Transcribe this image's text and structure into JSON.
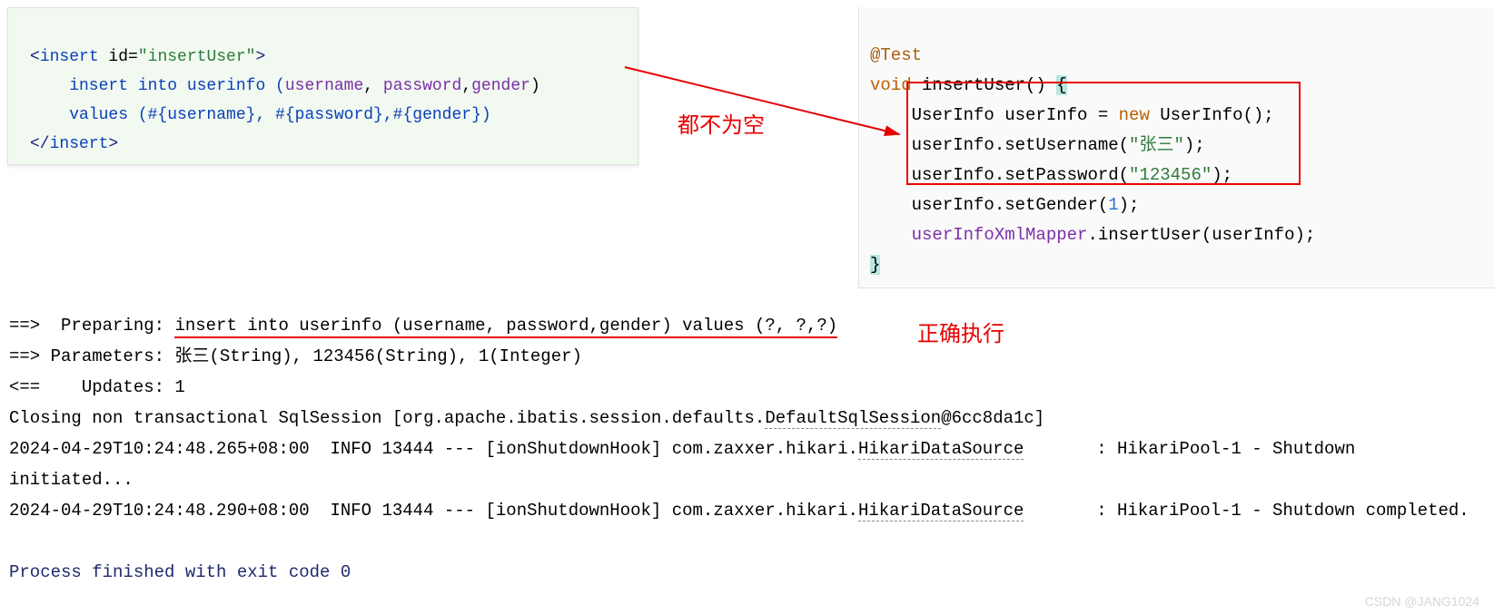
{
  "xml": {
    "open_tag_lt": "<",
    "open_tag_name": "insert",
    "attr_name": " id",
    "attr_eq": "=",
    "attr_val": "\"insertUser\"",
    "open_tag_gt": ">",
    "line2a": "    insert into userinfo (",
    "line2b": "username",
    "line2c": ", ",
    "line2d": "password",
    "line2e": ",",
    "line2f": "gender",
    "line2g": ")",
    "line3": "    values (#{username}, #{password},#{gender})",
    "close_lt": "</",
    "close_name": "insert",
    "close_gt": ">"
  },
  "java": {
    "ann": "@Test",
    "kw_void": "void",
    "method": " insertUser() ",
    "brace_open": "{",
    "line3a": "    UserInfo userInfo = ",
    "kw_new": "new",
    "line3b": " UserInfo();",
    "line4a": "    userInfo.setUsername(",
    "str1": "\"张三\"",
    "line4b": ");",
    "line5a": "    userInfo.setPassword(",
    "str2": "\"123456\"",
    "line5b": ");",
    "line6a": "    userInfo.setGender(",
    "num1": "1",
    "line6b": ");",
    "line7a": "    ",
    "mapper": "userInfoXmlMapper",
    "line7b": ".insertUser(userInfo);",
    "brace_close": "}"
  },
  "labels": {
    "not_empty": "都不为空",
    "correct_exec": "正确执行"
  },
  "console": {
    "l1a": "==>  Preparing: ",
    "l1b": "insert into userinfo (username, password,gender) values (?, ?,?)",
    "l2": "==> Parameters: 张三(String), 123456(String), 1(Integer)",
    "l3": "<==    Updates: 1",
    "l4a": "Closing non transactional SqlSession [org.apache.ibatis.session.defaults.",
    "l4b": "DefaultSqlSession",
    "l4c": "@6cc8da1c]",
    "l5a": "2024-04-29T10:24:48.265+08:00  INFO 13444 --- [ionShutdownHook] com.zaxxer.hikari.",
    "l5b": "HikariDataSource",
    "l5c": "       : HikariPool-1 - Shutdown initiated...",
    "l6a": "2024-04-29T10:24:48.290+08:00  INFO 13444 --- [ionShutdownHook] com.zaxxer.hikari.",
    "l6b": "HikariDataSource",
    "l6c": "       : HikariPool-1 - Shutdown completed.",
    "l7": "Process finished with exit code 0"
  },
  "watermark": "CSDN @JANG1024"
}
